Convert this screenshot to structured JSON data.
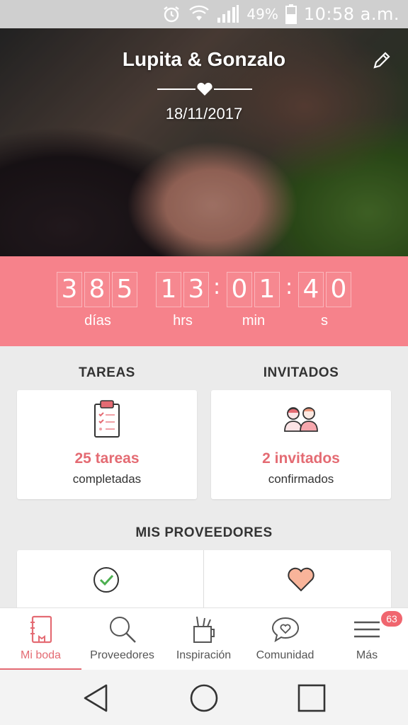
{
  "status_bar": {
    "battery_percent": "49%",
    "time": "10:58 a.m."
  },
  "hero": {
    "couple": "Lupita & Gonzalo",
    "date": "18/11/2017"
  },
  "countdown": {
    "days": [
      "3",
      "8",
      "5"
    ],
    "hours": [
      "1",
      "3"
    ],
    "minutes": [
      "0",
      "1"
    ],
    "seconds": [
      "4",
      "0"
    ],
    "separator": ":",
    "labels": {
      "days": "días",
      "hours": "hrs",
      "minutes": "min",
      "seconds": "s"
    }
  },
  "tasks": {
    "title": "TAREAS",
    "count": "25 tareas",
    "caption": "completadas"
  },
  "guests": {
    "title": "INVITADOS",
    "count": "2 invitados",
    "caption": "confirmados"
  },
  "providers": {
    "title": "MIS PROVEEDORES"
  },
  "bottom_nav": {
    "items": [
      {
        "label": "Mi boda",
        "icon": "notebook-icon",
        "active": true
      },
      {
        "label": "Proveedores",
        "icon": "search-icon"
      },
      {
        "label": "Inspiración",
        "icon": "pencil-cup-icon"
      },
      {
        "label": "Comunidad",
        "icon": "chat-heart-icon"
      },
      {
        "label": "Más",
        "icon": "menu-icon",
        "badge": "63"
      }
    ]
  },
  "colors": {
    "accent": "#f6828b",
    "accent_text": "#e46b73",
    "background": "#ebebeb"
  }
}
